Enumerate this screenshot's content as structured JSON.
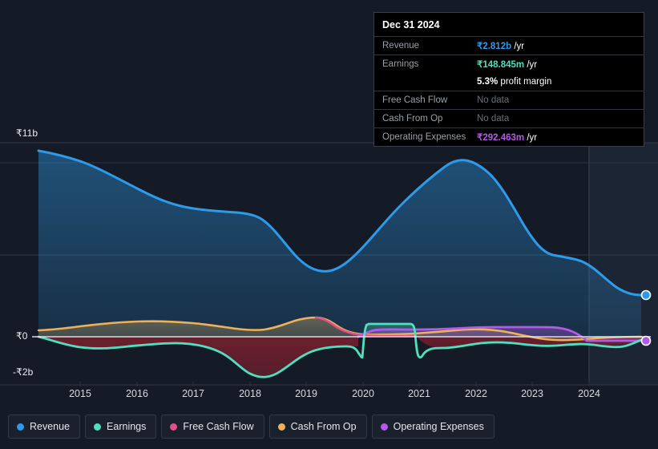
{
  "colors": {
    "background": "#151b26",
    "revenue": "#2e9bea",
    "earnings": "#4fe0c0",
    "free_cash_flow": "#e0518c",
    "cash_from_op": "#eeb159",
    "operating_expenses": "#b45ae8",
    "grid": "#333a46",
    "zero_line": "#e8eaed",
    "forecast_band": "#1d2736"
  },
  "tooltip": {
    "title": "Dec 31 2024",
    "rows": [
      {
        "label": "Revenue",
        "value": "₹2.812b",
        "unit": "/yr",
        "color": "#2e9bea",
        "no_data": false
      },
      {
        "label": "Earnings",
        "value": "₹148.845m",
        "unit": "/yr",
        "color": "#4fe0c0",
        "no_data": false
      },
      {
        "label": "",
        "value": "5.3%",
        "unit": "profit margin",
        "color": "#ffffff",
        "no_data": false
      },
      {
        "label": "Free Cash Flow",
        "value": "No data",
        "unit": "",
        "color": "#6b7075",
        "no_data": true
      },
      {
        "label": "Cash From Op",
        "value": "No data",
        "unit": "",
        "color": "#6b7075",
        "no_data": true
      },
      {
        "label": "Operating Expenses",
        "value": "₹292.463m",
        "unit": "/yr",
        "color": "#b45ae8",
        "no_data": false
      }
    ]
  },
  "legend": {
    "items": [
      {
        "label": "Revenue",
        "color": "#2e9bea"
      },
      {
        "label": "Earnings",
        "color": "#4fe0c0"
      },
      {
        "label": "Free Cash Flow",
        "color": "#e0518c"
      },
      {
        "label": "Cash From Op",
        "color": "#eeb159"
      },
      {
        "label": "Operating Expenses",
        "color": "#b45ae8"
      }
    ]
  },
  "chart_data": {
    "type": "area",
    "title": "",
    "xlabel": "",
    "ylabel": "",
    "currency": "₹",
    "grid": true,
    "legend_position": "bottom",
    "ylim": [
      -2000000000,
      11000000000
    ],
    "y_ticks": [
      {
        "label": "₹11b",
        "value": 11000000000
      },
      {
        "label": "₹0",
        "value": 0
      },
      {
        "label": "-₹2b",
        "value": -2000000000
      }
    ],
    "x_ticks": [
      "2015",
      "2016",
      "2017",
      "2018",
      "2019",
      "2020",
      "2021",
      "2022",
      "2023",
      "2024"
    ],
    "xlim": [
      "2014.3",
      "2025.0"
    ],
    "forecast_region_start": "2024.0",
    "series": [
      {
        "name": "Revenue",
        "color": "#2e9bea",
        "filled": true,
        "x": [
          2014.4,
          2015.0,
          2015.5,
          2016.0,
          2016.5,
          2017.0,
          2017.4,
          2017.8,
          2018.2,
          2018.6,
          2019.0,
          2019.4,
          2019.8,
          2020.1,
          2020.4,
          2020.8,
          2021.2,
          2021.6,
          2022.0,
          2022.3,
          2022.7,
          2023.0,
          2023.4,
          2023.8,
          2024.2,
          2024.6,
          2025.0
        ],
        "values": [
          10.45,
          10.25,
          9.9,
          9.3,
          8.5,
          8.1,
          8.0,
          7.95,
          6.9,
          5.8,
          6.6,
          7.0,
          6.2,
          4.8,
          4.35,
          5.2,
          6.6,
          8.2,
          9.4,
          9.2,
          7.4,
          5.7,
          5.6,
          5.4,
          4.0,
          3.0,
          2.812
        ],
        "unit": "b"
      },
      {
        "name": "Earnings",
        "color": "#4fe0c0",
        "filled": true,
        "x": [
          2014.4,
          2015.0,
          2015.5,
          2016.0,
          2016.5,
          2017.0,
          2017.5,
          2018.0,
          2018.4,
          2018.9,
          2019.4,
          2019.9,
          2020.0,
          2020.5,
          2021.0,
          2021.1,
          2021.5,
          2022.0,
          2022.5,
          2023.0,
          2023.5,
          2024.0,
          2024.5,
          2025.0
        ],
        "values": [
          0.0,
          -0.28,
          -0.45,
          -0.4,
          -0.3,
          -0.33,
          -0.45,
          -0.95,
          -1.15,
          -0.75,
          -0.55,
          -0.55,
          0.55,
          0.58,
          0.55,
          -0.35,
          -0.2,
          -0.12,
          -0.05,
          -0.25,
          -0.2,
          -0.35,
          -0.2,
          0.148845
        ],
        "unit": "b"
      },
      {
        "name": "Free Cash Flow",
        "color": "#e0518c",
        "filled": false,
        "x": [
          2019.1,
          2019.4,
          2019.8,
          2020.1,
          2020.5,
          2021.0
        ],
        "values": [
          0.62,
          0.5,
          0.25,
          0.08,
          0.03,
          0.02
        ],
        "unit": "b",
        "note": "partial coverage only"
      },
      {
        "name": "Cash From Op",
        "color": "#eeb159",
        "filled": true,
        "x": [
          2014.4,
          2015.0,
          2015.5,
          2016.0,
          2016.5,
          2017.0,
          2017.5,
          2018.0,
          2018.4,
          2018.9,
          2019.2,
          2019.6,
          2020.0,
          2020.5,
          2021.0,
          2021.5,
          2022.0,
          2022.5,
          2023.0,
          2023.5,
          2024.0,
          2024.5,
          2025.0
        ],
        "values": [
          0.28,
          0.33,
          0.43,
          0.5,
          0.5,
          0.47,
          0.4,
          0.35,
          0.3,
          0.45,
          0.62,
          0.45,
          0.18,
          0.1,
          0.1,
          0.12,
          0.2,
          0.22,
          0.1,
          -0.05,
          -0.1,
          -0.08,
          0.0
        ],
        "unit": "b"
      },
      {
        "name": "Operating Expenses",
        "color": "#b45ae8",
        "filled": false,
        "x": [
          2019.9,
          2020.2,
          2020.6,
          2021.0,
          2021.5,
          2022.0,
          2022.5,
          2023.0,
          2023.5,
          2024.0,
          2024.5,
          2025.0
        ],
        "values": [
          0.02,
          0.2,
          0.22,
          0.22,
          0.2,
          0.25,
          0.28,
          0.28,
          0.28,
          0.3,
          0.3,
          0.292463
        ],
        "unit": "b"
      }
    ],
    "end_markers": [
      {
        "series": "Revenue",
        "color": "#2e9bea",
        "value": 2.812
      },
      {
        "series": "Operating Expenses",
        "color": "#b45ae8",
        "value": 0.292463
      }
    ]
  }
}
